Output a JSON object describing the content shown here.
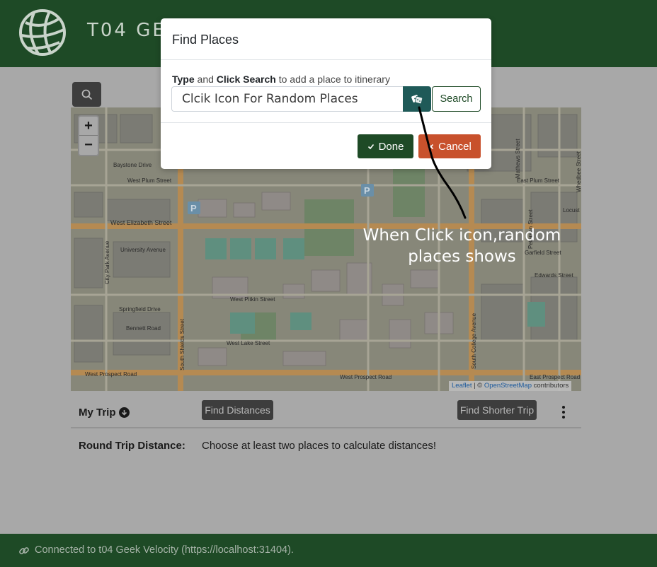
{
  "header": {
    "title": "T04 GE",
    "logo_icon": "globe-icon"
  },
  "map": {
    "zoom_in": "+",
    "zoom_out": "−",
    "attribution_leaflet": "Leaflet",
    "attribution_sep": " | © ",
    "attribution_osm": "OpenStreetMap",
    "attribution_suffix": " contributors",
    "street_labels": [
      "Baystone Drive",
      "West Plum Street",
      "West Elizabeth Street",
      "University Avenue",
      "Springfield Drive",
      "Bennett Road",
      "West Pitkin Street",
      "West Lake Street",
      "West Prospect Road",
      "South Shields Street",
      "South College Avenue",
      "East Plum Street",
      "Garfield Street",
      "Edwards Street",
      "East Prospect Road",
      "City Park Avenue",
      "Mathews Street",
      "Peterson Street",
      "Locust",
      "Whedbee Street"
    ]
  },
  "trip": {
    "title": "My Trip",
    "find_distances": "Find Distances",
    "find_shorter": "Find Shorter Trip",
    "distance_label": "Round Trip Distance:",
    "distance_value": "Choose at least two places to calculate distances!"
  },
  "footer": {
    "status": "Connected to t04 Geek Velocity  (https://localhost:31404)."
  },
  "modal": {
    "title": "Find Places",
    "instr_type": "Type",
    "instr_and": " and ",
    "instr_click": "Click Search",
    "instr_rest": " to add a place to itinerary",
    "input_value": "Clcik Icon For Random Places",
    "search_label": "Search",
    "done_label": "Done",
    "cancel_label": "Cancel"
  },
  "annotation": {
    "text": "When Click icon,random places shows"
  },
  "colors": {
    "header_bg": "#1e4a26",
    "done_bg": "#1e4a26",
    "cancel_bg": "#c8512c",
    "dice_bg": "#1f5a58"
  }
}
